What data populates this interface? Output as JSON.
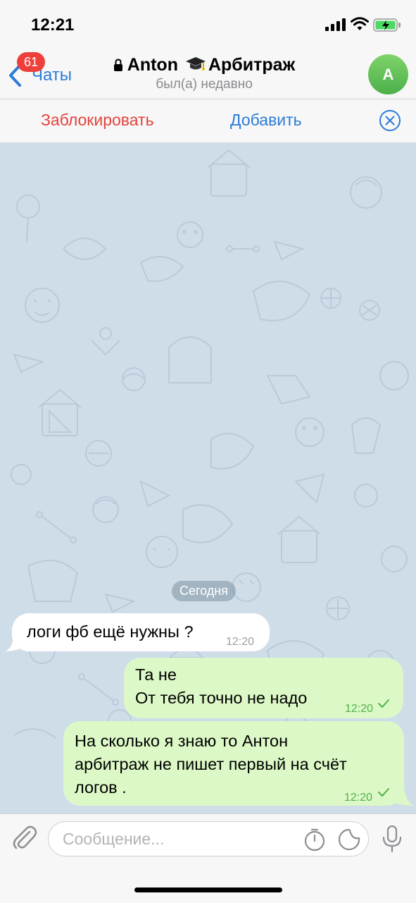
{
  "status_bar": {
    "time": "12:21"
  },
  "nav": {
    "back_label": "Чаты",
    "unread_badge": "61",
    "chat_name_first": "Anton",
    "chat_name_second": "Арбитраж",
    "subtitle": "был(а) недавно",
    "avatar_initial": "A"
  },
  "actions": {
    "block_label": "Заблокировать",
    "add_label": "Добавить"
  },
  "chat": {
    "date_separator": "Сегодня",
    "messages": [
      {
        "direction": "incoming",
        "text": "логи фб ещё нужны ?",
        "time": "12:20"
      },
      {
        "direction": "outgoing",
        "lines": [
          "Та не",
          "От тебя точно не надо"
        ],
        "time": "12:20",
        "status": "sent"
      },
      {
        "direction": "outgoing",
        "lines": [
          "На сколько я знаю то Антон",
          "арбитраж не пишет первый на счёт",
          "логов ."
        ],
        "time": "12:20",
        "status": "sent"
      }
    ]
  },
  "composer": {
    "placeholder": "Сообщение..."
  },
  "colors": {
    "accent_blue": "#2c7bd6",
    "danger_red": "#e5423c",
    "badge_red": "#ef3f3b",
    "outgoing_bubble": "#dcf8c6",
    "chat_background": "#cfdde9",
    "check_green": "#4fb24a"
  }
}
